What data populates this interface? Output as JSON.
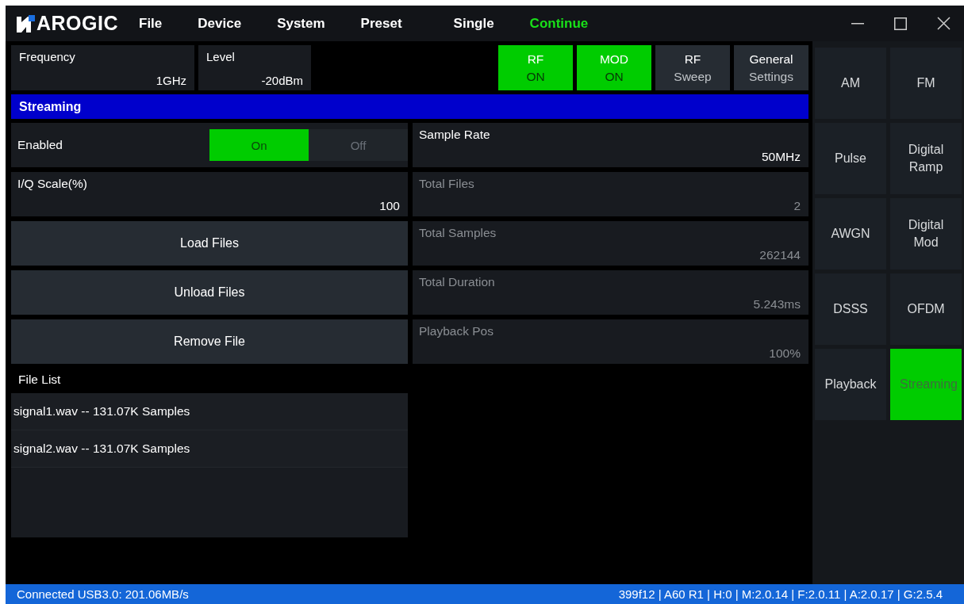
{
  "title_bar": {
    "logo": "AROGIC",
    "menus": [
      {
        "label": "File"
      },
      {
        "label": "Device"
      },
      {
        "label": "System"
      },
      {
        "label": "Preset"
      }
    ],
    "modes": [
      {
        "label": "Single",
        "selected": false
      },
      {
        "label": "Continue",
        "selected": true
      }
    ]
  },
  "top_fields": [
    {
      "label": "Frequency",
      "value": "1GHz"
    },
    {
      "label": "Level",
      "value": "-20dBm"
    }
  ],
  "top_buttons": [
    {
      "label": "RF",
      "sub": "ON",
      "on": true
    },
    {
      "label": "MOD",
      "sub": "ON",
      "on": true
    },
    {
      "label": "RF",
      "sub": "Sweep",
      "on": false
    },
    {
      "label": "General",
      "sub": "Settings",
      "on": false
    }
  ],
  "section_title": "Streaming",
  "left_rows": [
    {
      "kind": "toggle",
      "label": "Enabled",
      "options": [
        {
          "label": "On",
          "selected": true
        },
        {
          "label": "Off",
          "selected": false
        }
      ]
    },
    {
      "kind": "field",
      "label": "I/Q Scale(%)",
      "value": "100",
      "disabled": false
    },
    {
      "kind": "button",
      "label": "Load Files"
    },
    {
      "kind": "button",
      "label": "Unload Files"
    },
    {
      "kind": "button",
      "label": "Remove File"
    }
  ],
  "right_rows": [
    {
      "label": "Sample Rate",
      "value": "50MHz",
      "disabled": false
    },
    {
      "label": "Total Files",
      "value": "2",
      "disabled": true
    },
    {
      "label": "Total Samples",
      "value": "262144",
      "disabled": true
    },
    {
      "label": "Total Duration",
      "value": "5.243ms",
      "disabled": true
    },
    {
      "label": "Playback Pos",
      "value": "100%",
      "disabled": true
    }
  ],
  "file_list": {
    "title": "File List",
    "items": [
      "signal1.wav -- 131.07K Samples",
      "signal2.wav -- 131.07K Samples"
    ]
  },
  "sidebar": [
    {
      "label": "AM",
      "selected": false
    },
    {
      "label": "Pulse",
      "selected": false
    },
    {
      "label": "AWGN",
      "selected": false
    },
    {
      "label": "DSSS",
      "selected": false
    },
    {
      "label": "Playback",
      "selected": false
    },
    {
      "label": "FM",
      "selected": false
    },
    {
      "label": "Digital Ramp",
      "selected": false
    },
    {
      "label": "Digital Mod",
      "selected": false
    },
    {
      "label": "OFDM",
      "selected": false
    },
    {
      "label": "Streaming",
      "selected": true
    }
  ],
  "status_bar": {
    "left": "Connected USB3.0: 201.06MB/s",
    "right": "399f12 | A60 R1 | H:0 | M:2.0.14 | F:2.0.11 | A:2.0.17 | G:2.5.4"
  }
}
